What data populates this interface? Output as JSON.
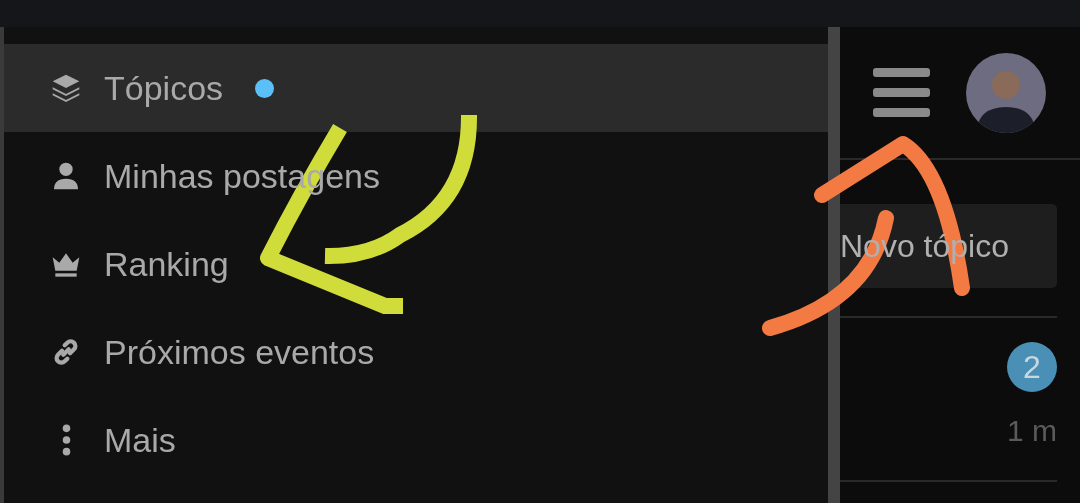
{
  "menu": {
    "items": [
      {
        "label": "Tópicos",
        "selected": true,
        "unread": true
      },
      {
        "label": "Minhas postagens",
        "selected": false,
        "unread": false
      },
      {
        "label": "Ranking",
        "selected": false,
        "unread": false
      },
      {
        "label": "Próximos eventos",
        "selected": false,
        "unread": false
      },
      {
        "label": "Mais",
        "selected": false,
        "unread": false
      }
    ]
  },
  "header": {
    "new_topic_button": "Novo tópico"
  },
  "topic": {
    "reply_count": "2",
    "age": "1 m"
  }
}
